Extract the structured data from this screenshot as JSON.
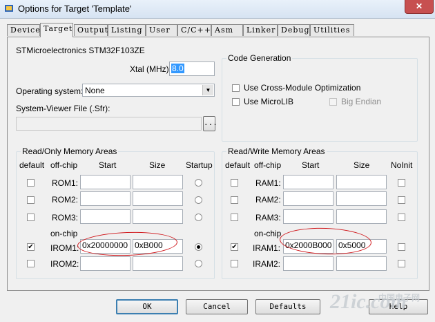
{
  "window": {
    "title": "Options for Target 'Template'",
    "close": "✕"
  },
  "tabs": [
    "Device",
    "Target",
    "Output",
    "Listing",
    "User",
    "C/C++",
    "Asm",
    "Linker",
    "Debug",
    "Utilities"
  ],
  "device": {
    "name": "STMicroelectronics STM32F103ZE"
  },
  "xtal": {
    "label": "Xtal (MHz):",
    "value": "8.0"
  },
  "os": {
    "label": "Operating system:",
    "value": "None"
  },
  "sysviewer": {
    "label": "System-Viewer File (.Sfr):",
    "value": "",
    "browse": "..."
  },
  "codegen": {
    "title": "Code Generation",
    "cross_module": "Use Cross-Module Optimization",
    "microlib": "Use MicroLIB",
    "big_endian": "Big Endian"
  },
  "rom": {
    "title": "Read/Only Memory Areas",
    "headers": {
      "default": "default",
      "offchip": "off-chip",
      "start": "Start",
      "size": "Size",
      "startup": "Startup"
    },
    "onchip": "on-chip",
    "rows": [
      {
        "name": "ROM1:",
        "start": "",
        "size": "",
        "checked": false,
        "startup": false
      },
      {
        "name": "ROM2:",
        "start": "",
        "size": "",
        "checked": false,
        "startup": false
      },
      {
        "name": "ROM3:",
        "start": "",
        "size": "",
        "checked": false,
        "startup": false
      },
      {
        "name": "IROM1:",
        "start": "0x20000000",
        "size": "0xB000",
        "checked": true,
        "startup": true
      },
      {
        "name": "IROM2:",
        "start": "",
        "size": "",
        "checked": false,
        "startup": false
      }
    ]
  },
  "ram": {
    "title": "Read/Write Memory Areas",
    "headers": {
      "default": "default",
      "offchip": "off-chip",
      "start": "Start",
      "size": "Size",
      "noinit": "NoInit"
    },
    "onchip": "on-chip",
    "rows": [
      {
        "name": "RAM1:",
        "start": "",
        "size": "",
        "checked": false,
        "noinit": false
      },
      {
        "name": "RAM2:",
        "start": "",
        "size": "",
        "checked": false,
        "noinit": false
      },
      {
        "name": "RAM3:",
        "start": "",
        "size": "",
        "checked": false,
        "noinit": false
      },
      {
        "name": "IRAM1:",
        "start": "0x2000B000",
        "size": "0x5000",
        "checked": true,
        "noinit": false
      },
      {
        "name": "IRAM2:",
        "start": "",
        "size": "",
        "checked": false,
        "noinit": false
      }
    ]
  },
  "buttons": {
    "ok": "OK",
    "cancel": "Cancel",
    "defaults": "Defaults",
    "help": "Help"
  },
  "watermark": {
    "text": "21ic.com",
    "sub": "中国电子网"
  }
}
